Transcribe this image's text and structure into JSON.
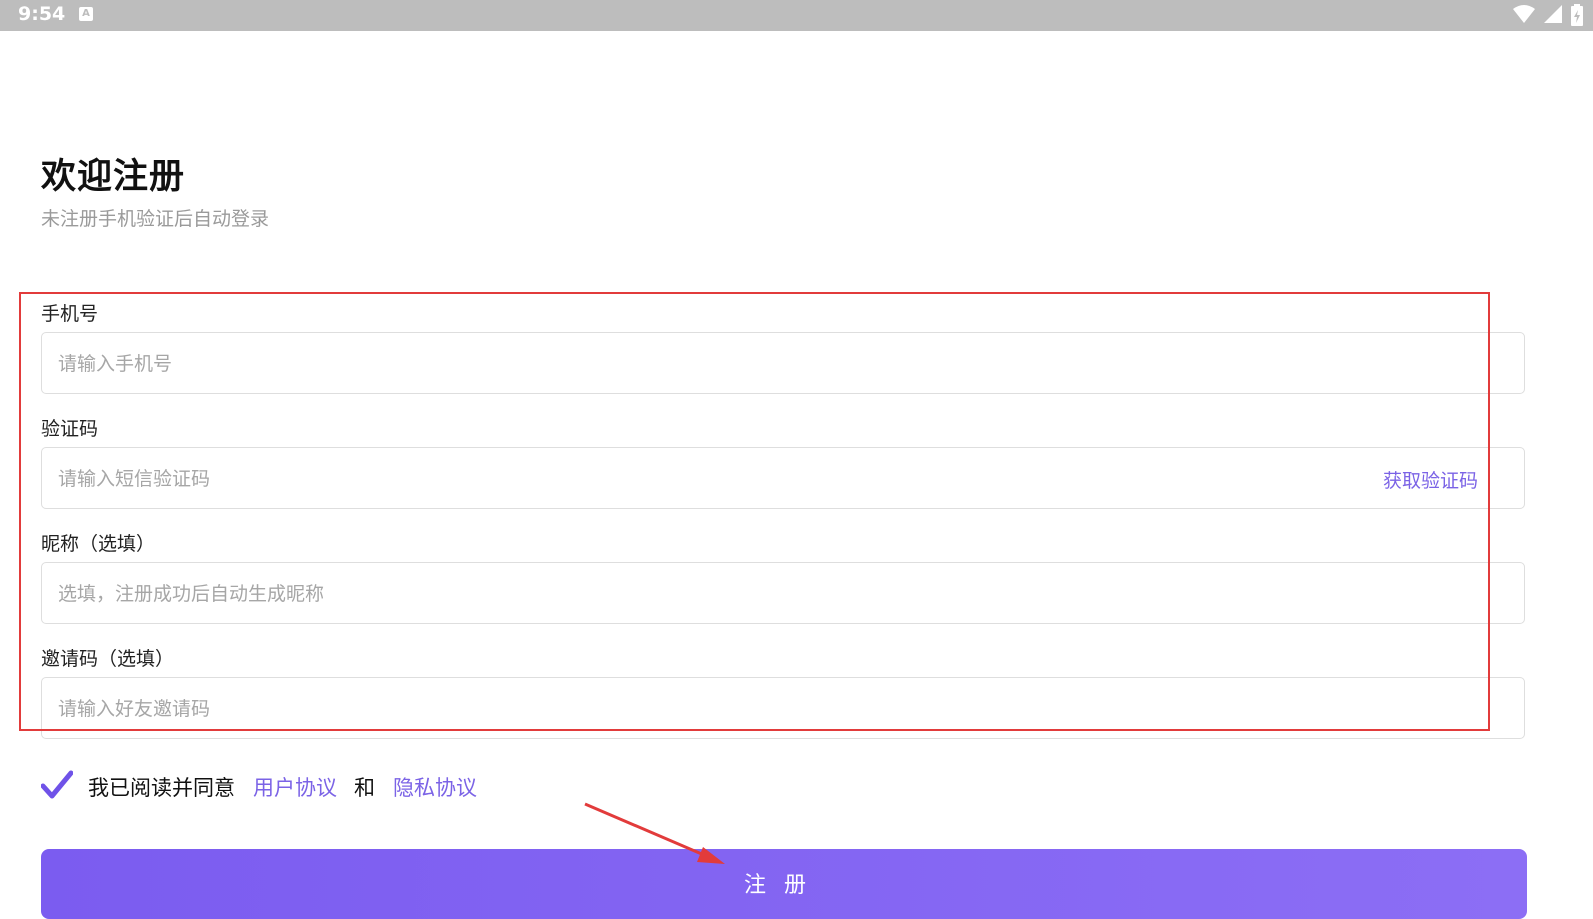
{
  "status_bar": {
    "time": "9:54",
    "notif_icon": "A"
  },
  "header": {
    "title": "欢迎注册",
    "subtitle": "未注册手机验证后自动登录"
  },
  "form": {
    "phone": {
      "label": "手机号",
      "placeholder": "请输入手机号"
    },
    "code": {
      "label": "验证码",
      "placeholder": "请输入短信验证码",
      "action": "获取验证码"
    },
    "nickname": {
      "label": "昵称（选填）",
      "placeholder": "选填，注册成功后自动生成昵称"
    },
    "invite": {
      "label": "邀请码（选填）",
      "placeholder": "请输入好友邀请码"
    }
  },
  "agreement": {
    "text": "我已阅读并同意",
    "user_link": "用户协议",
    "and": "和",
    "privacy_link": "隐私协议"
  },
  "submit_label": "注册",
  "colors": {
    "accent": "#7b63e6",
    "highlight": "#e23b3b"
  }
}
